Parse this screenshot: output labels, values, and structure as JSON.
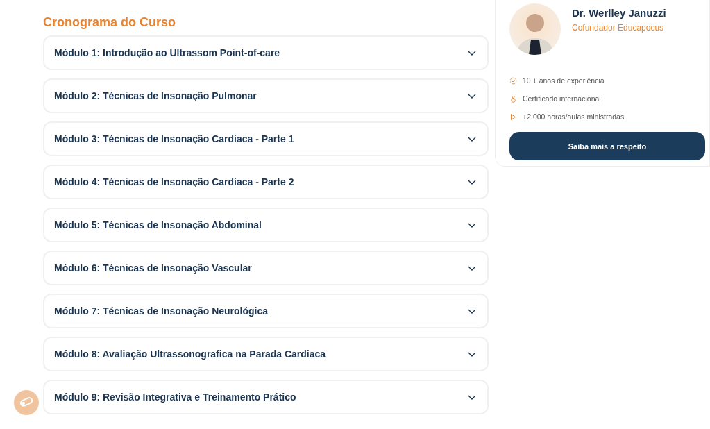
{
  "schedule": {
    "title": "Cronograma do Curso",
    "modules": [
      {
        "title": "Módulo 1: Introdução ao Ultrassom Point-of-care",
        "expanded": false
      },
      {
        "title": "Módulo 2: Técnicas de Insonação Pulmonar",
        "expanded": false
      },
      {
        "title": "Módulo 3: Técnicas de Insonação Cardíaca - Parte 1",
        "expanded": false
      },
      {
        "title": "Módulo 4: Técnicas de Insonação Cardíaca - Parte 2",
        "expanded": false
      },
      {
        "title": "Módulo 5: Técnicas de Insonação Abdominal",
        "expanded": false
      },
      {
        "title": "Módulo 6: Técnicas de Insonação Vascular",
        "expanded": false
      },
      {
        "title": "Módulo 7: Técnicas de Insonação Neurológica",
        "expanded": false
      },
      {
        "title": "Módulo 8: Avaliação Ultrassonografica na Parada Cardiaca",
        "expanded": false
      },
      {
        "title": "Módulo 9: Revisão Integrativa e Treinamento Prático",
        "expanded": false
      }
    ]
  },
  "instructor": {
    "name": "Dr. Werlley Januzzi",
    "role": "Cofundador Educapocus",
    "facts": [
      {
        "kind": "experience",
        "text": "10 + anos de experiência"
      },
      {
        "kind": "certificate",
        "text": "Certificado internacional"
      },
      {
        "kind": "hours",
        "text": "+2.000 horas/aulas ministradas"
      }
    ],
    "button": "Saiba mais a respeito"
  }
}
